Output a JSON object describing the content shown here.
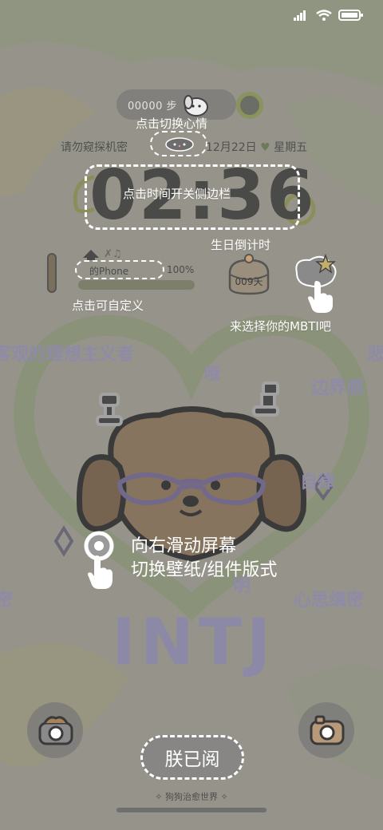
{
  "status_bar": {
    "icons": [
      "signal-icon",
      "wifi-icon",
      "battery-icon"
    ]
  },
  "widgets": {
    "steps": "00000 步",
    "privacy_text": "请勿窥探机密",
    "date_text": "12月22日",
    "weekday_text": "星期五",
    "clock": "02:36",
    "battery_label": "的Phone",
    "battery_percent": "100%",
    "battery_level": 1.0,
    "countdown": "009天"
  },
  "hints": {
    "mood": "点击切换心情",
    "sidebar": "点击时间开关侧边栏",
    "birthday": "生日倒计时",
    "customize": "点击可自定义",
    "mbti": "来选择你的MBTI吧",
    "swipe_line1": "向右滑动屏幕",
    "swipe_line2": "切换壁纸/组件版式"
  },
  "wallpaper_text": {
    "line1": "客观的理想主义者",
    "right_edge": "悲",
    "oh": "哦",
    "boundary": "边界感",
    "self_discipline": "自律",
    "ming": "明",
    "left_edge": "密",
    "thoughts": "心思缜密",
    "type": "INTJ"
  },
  "actions": {
    "acknowledge": "朕已阅"
  },
  "footer": "狗狗治愈世界",
  "colors": {
    "accent_purple": "#8e8aa8",
    "dog_brown": "#c9a277",
    "overlay": "#464646"
  }
}
